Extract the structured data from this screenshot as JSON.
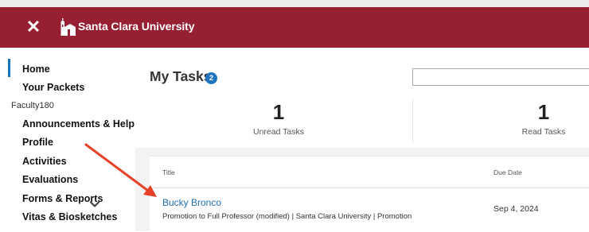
{
  "header": {
    "close_glyph": "✕",
    "brand": "Santa Clara University"
  },
  "sidebar": {
    "items_top": [
      {
        "label": "Home"
      },
      {
        "label": "Your Packets"
      }
    ],
    "section_label": "Faculty180",
    "items": [
      {
        "label": "Announcements & Help"
      },
      {
        "label": "Profile"
      },
      {
        "label": "Activities"
      },
      {
        "label": "Evaluations"
      },
      {
        "label": "Forms & Reports"
      },
      {
        "label": "Vitas & Biosketches"
      }
    ]
  },
  "main": {
    "title": "My Tasks",
    "badge_count": "2",
    "stats": [
      {
        "value": "1",
        "label": "Unread Tasks"
      },
      {
        "value": "1",
        "label": "Read Tasks"
      }
    ],
    "table": {
      "columns": [
        "Title",
        "Due Date"
      ],
      "rows": [
        {
          "name": "Bucky Bronco",
          "subtitle": "Promotion to Full Professor (modified)  | Santa Clara University | Promotion",
          "due": "Sep 4, 2024"
        }
      ]
    }
  },
  "colors": {
    "brand": "#962032",
    "link": "#1f6fb3",
    "badge": "#1f74bf",
    "annotation_arrow": "#e8412a"
  }
}
